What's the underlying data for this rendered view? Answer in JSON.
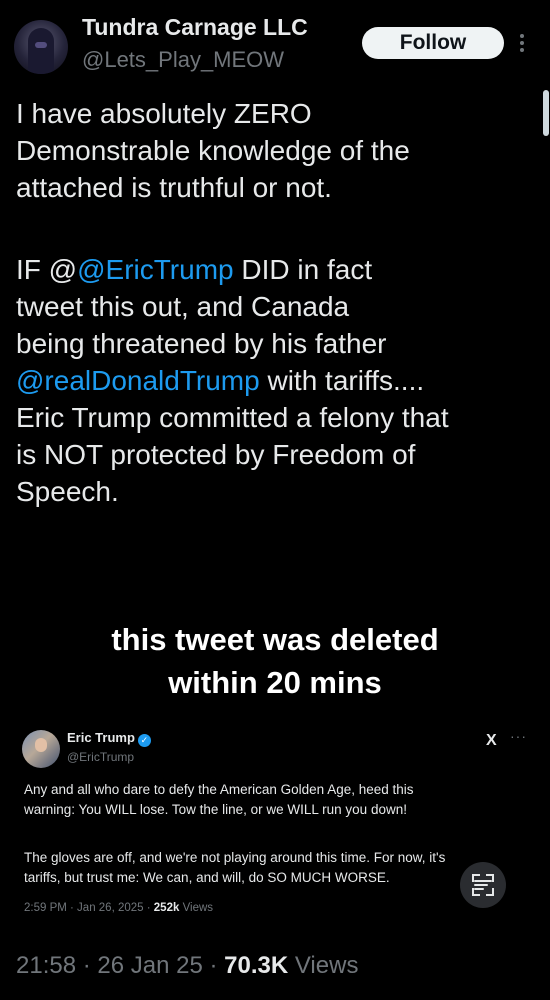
{
  "author": {
    "display_name": "Tundra Carnage LLC",
    "handle": "@Lets_Play_MEOW"
  },
  "actions": {
    "follow_label": "Follow",
    "more_icon": "vertical-ellipsis-icon"
  },
  "tweet": {
    "lines": [
      "I have absolutely ZERO",
      "Demonstrable knowledge of the",
      "attached is truthful or not."
    ],
    "line4_pre": "IF @",
    "line4_mention": "@EricTrump",
    "line4_post": " DID in fact",
    "line5": "tweet this out, and Canada",
    "line6": "being threatened by his father",
    "line7_mention": "@realDonaldTrump",
    "line7_post": " with tariffs....",
    "line8": "Eric Trump committed a felony that",
    "line9": "is NOT protected by Freedom of",
    "line10": "Speech."
  },
  "embed": {
    "caption_line1": "this tweet was deleted",
    "caption_line2": "within 20 mins",
    "name": "Eric Trump",
    "handle": "@EricTrump",
    "x_logo": "X",
    "more": "···",
    "text_line1": "Any and all who dare to defy the American Golden Age, heed this",
    "text_line2": "warning: You WILL lose. Tow the line, or we WILL run you down!",
    "text_line3": "The gloves are off, and we're not playing around this time. For now, it's",
    "text_line4": "tariffs, but trust me: We can, and will, do SO MUCH WORSE.",
    "time": "2:59 PM · Jan 26, 2025 · ",
    "views_count": "252k",
    "views_label": " Views"
  },
  "footer": {
    "time": "21:58 · 26 Jan 25 · ",
    "views_count": "70.3K",
    "views_label": " Views"
  },
  "colors": {
    "background": "#000000",
    "text": "#e7e9ea",
    "secondary": "#71767b",
    "link": "#1d9bf0",
    "follow_bg": "#eff3f4"
  }
}
